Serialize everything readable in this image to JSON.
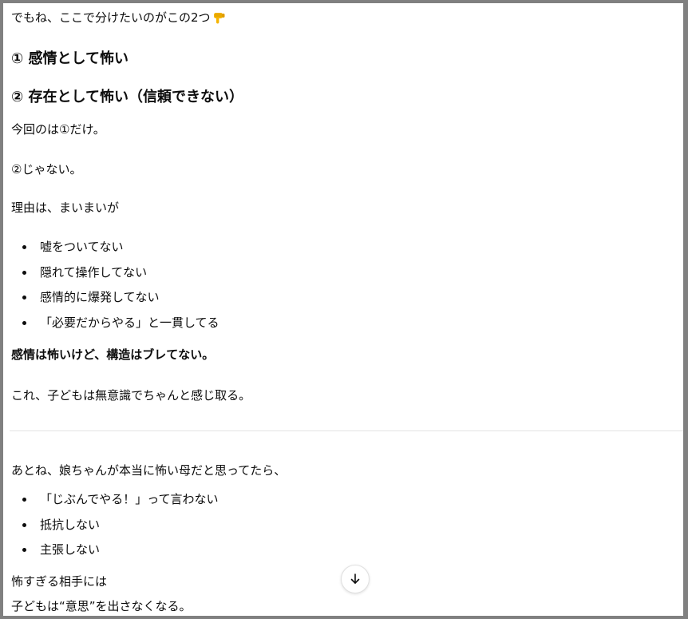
{
  "chat": {
    "intro": "でもね、ここで分けたいのがこの2つ",
    "intro_emoji": "backhand-index-pointing-down-icon",
    "heading_1": "① 感情として怖い",
    "heading_2": "② 存在として怖い（信頼できない）",
    "p_only_1": "今回のは①だけ。",
    "p_not_2": "②じゃない。",
    "p_reason": "理由は、まいまいが",
    "reasons": [
      "嘘をついてない",
      "隠れて操作してない",
      "感情的に爆発してない",
      "「必要だからやる」と一貫してる"
    ],
    "p_bold_summary": "感情は怖いけど、構造はブレてない。",
    "p_child_feel": "これ、子どもは無意識でちゃんと感じ取る。",
    "p_also": "あとね、娘ちゃんが本当に怖い母だと思ってたら、",
    "signs": [
      "「じぶんでやる！」って言わない",
      "抵抗しない",
      "主張しない"
    ],
    "p_too_scary": "怖すぎる相手には",
    "p_no_will": "子どもは“意思”を出さなくなる。"
  },
  "scroll_button": {
    "icon": "arrow-down-icon"
  },
  "colors": {
    "frame": "#808080",
    "text": "#0d0d0d",
    "divider": "#e3e3e3",
    "emoji_skin": "#f5b400"
  }
}
